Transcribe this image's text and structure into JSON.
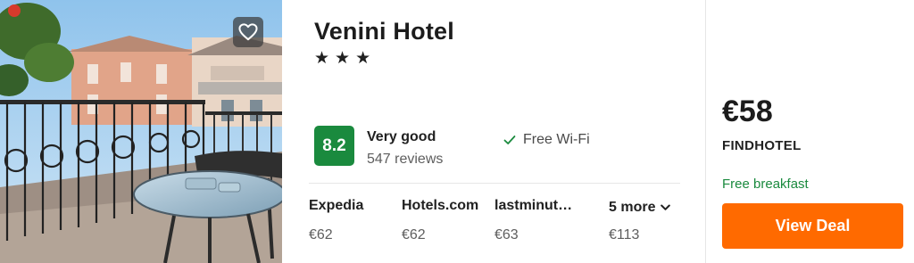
{
  "hotel": {
    "name": "Venini Hotel",
    "star_count": 3,
    "stars": [
      "★",
      "★",
      "★"
    ]
  },
  "rating": {
    "score": "8.2",
    "label": "Very good",
    "reviews": "547 reviews",
    "badge_color": "#1a8a3e"
  },
  "amenity": {
    "label": "Free Wi-Fi",
    "icon": "check-icon"
  },
  "providers": [
    {
      "name": "Expedia",
      "price": "€62"
    },
    {
      "name": "Hotels.com",
      "price": "€62"
    },
    {
      "name": "lastminut…",
      "price": "€63"
    }
  ],
  "more": {
    "label": "5 more",
    "price": "€113",
    "icon": "chevron-down-icon"
  },
  "deal": {
    "price": "€58",
    "provider": "FINDHOTEL",
    "perk": "Free breakfast",
    "button_label": "View Deal",
    "button_color": "#ff6a00"
  },
  "photo": {
    "favorite_icon": "heart-icon"
  }
}
